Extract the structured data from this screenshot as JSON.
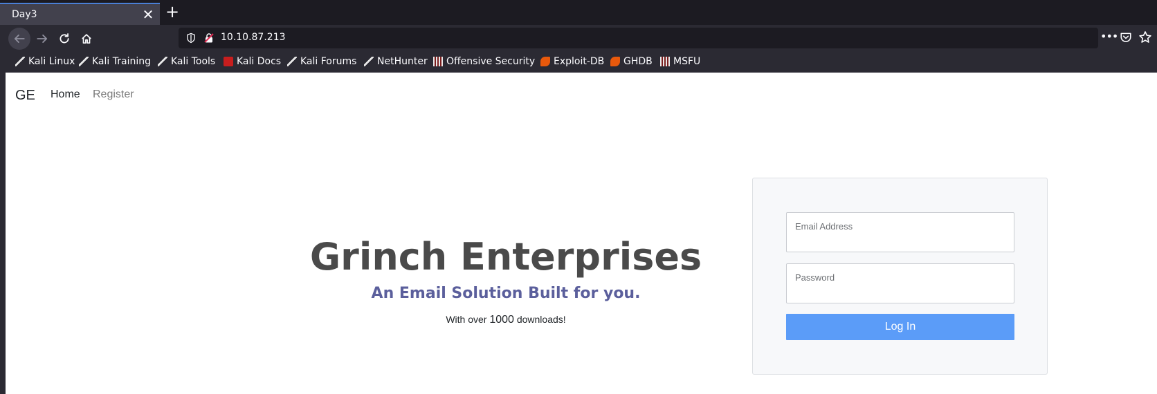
{
  "browser": {
    "tab": {
      "title": "Day3",
      "close_label": "✕"
    },
    "new_tab_label": "+",
    "address": "10.10.87.213",
    "page_actions_label": "•••",
    "bookmarks": [
      {
        "label": "Kali Linux",
        "icon": "kali-dragon-icon"
      },
      {
        "label": "Kali Training",
        "icon": "kali-dragon-icon"
      },
      {
        "label": "Kali Tools",
        "icon": "kali-dragon-icon"
      },
      {
        "label": "Kali Docs",
        "icon": "kali-docs-icon"
      },
      {
        "label": "Kali Forums",
        "icon": "kali-dragon-icon"
      },
      {
        "label": "NetHunter",
        "icon": "kali-dragon-icon"
      },
      {
        "label": "Offensive Security",
        "icon": "offsec-icon"
      },
      {
        "label": "Exploit-DB",
        "icon": "exploit-db-icon"
      },
      {
        "label": "GHDB",
        "icon": "exploit-db-icon"
      },
      {
        "label": "MSFU",
        "icon": "offsec-icon"
      }
    ],
    "colors": {
      "chrome": "#2b2a33",
      "tabstrip": "#1c1b22",
      "active_tab_accent": "#4a7fd6"
    }
  },
  "site": {
    "nav": {
      "brand": "GE",
      "home": "Home",
      "register": "Register"
    },
    "hero": {
      "title": "Grinch Enterprises",
      "subtitle": "An Email Solution Built for you.",
      "tagline_before": "With over ",
      "tagline_number": "1000",
      "tagline_after": " downloads!"
    },
    "login": {
      "email_placeholder": "Email Address",
      "password_placeholder": "Password",
      "submit_label": "Log In"
    },
    "colors": {
      "title": "#4a4a4a",
      "subtitle": "#5b5f9c",
      "button": "#5b9cf8"
    }
  }
}
